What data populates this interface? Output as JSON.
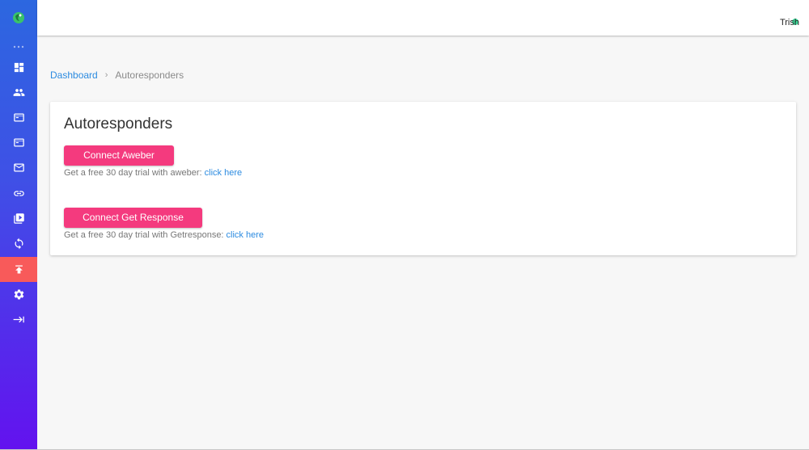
{
  "header": {
    "user_name": "Trish"
  },
  "sidebar": {
    "items": [
      {
        "icon": "dashboard-icon",
        "active": false
      },
      {
        "icon": "users-icon",
        "active": false
      },
      {
        "icon": "browser-window-icon",
        "active": false
      },
      {
        "icon": "browser-window-icon",
        "active": false
      },
      {
        "icon": "mail-icon",
        "active": false
      },
      {
        "icon": "link-icon",
        "active": false
      },
      {
        "icon": "video-library-icon",
        "active": false
      },
      {
        "icon": "sync-icon",
        "active": false
      },
      {
        "icon": "upload-icon",
        "active": true
      },
      {
        "icon": "gear-icon",
        "active": false
      },
      {
        "icon": "collapse-sidebar-icon",
        "active": false
      }
    ]
  },
  "breadcrumb": {
    "home": "Dashboard",
    "separator": "›",
    "current": "Autoresponders"
  },
  "card": {
    "title": "Autoresponders",
    "aweber": {
      "button_label": "Connect Aweber",
      "trial_text": "Get a free 30 day trial with aweber: ",
      "link_text": "click here"
    },
    "getresponse": {
      "button_label": "Connect Get Response",
      "trial_text": "Get a free 30 day trial with Getresponse: ",
      "link_text": "click here"
    }
  },
  "colors": {
    "accent_button": "#f43a7e",
    "active_nav": "#f85a5a",
    "link": "#2c8be0",
    "sidebar_top": "#2c67e0",
    "sidebar_bottom": "#6312ef"
  }
}
